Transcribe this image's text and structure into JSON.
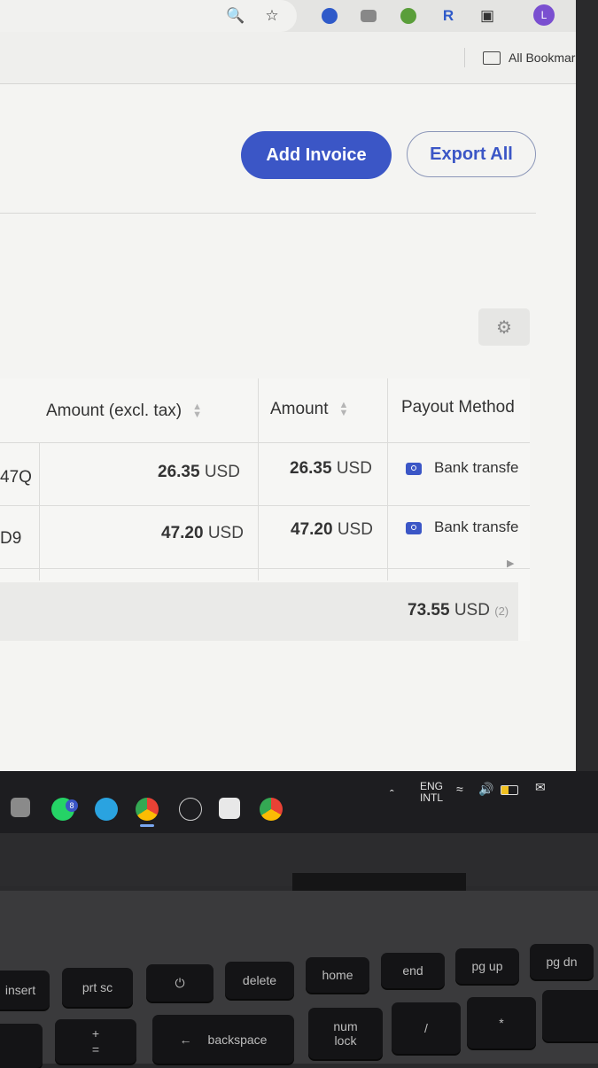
{
  "browser": {
    "profile_initial": "L",
    "bookmarks_label": "All Bookmarks",
    "icons": [
      "zoom-icon",
      "star-icon",
      "extension-icon-1",
      "extension-icon-2",
      "extension-icon-3",
      "extension-icon-4",
      "puzzle-icon",
      "more-vert-icon"
    ]
  },
  "page": {
    "add_invoice_label": "Add Invoice",
    "export_all_label": "Export All",
    "table": {
      "headers": [
        "Amount (excl. tax)",
        "Amount",
        "Payout Method"
      ],
      "rows": [
        {
          "id_fragment": "47Q",
          "amount_excl": "26.35",
          "amount": "26.35",
          "currency": "USD",
          "payout": "Bank transfe"
        },
        {
          "id_fragment": "D9",
          "amount_excl": "47.20",
          "amount": "47.20",
          "currency": "USD",
          "payout": "Bank transfe"
        }
      ],
      "total": {
        "value": "73.55",
        "currency": "USD",
        "count": "(2)"
      }
    },
    "colors": {
      "accent": "#3b56c6"
    }
  },
  "taskbar": {
    "lang_line1": "ENG",
    "lang_line2": "INTL",
    "whatsapp_badge": "8"
  },
  "keyboard": {
    "keys": [
      "insert",
      "prt sc",
      "delete",
      "home",
      "end",
      "pg up",
      "pg dn",
      "+",
      "=",
      "backspace",
      "num",
      "lock",
      "/",
      "*"
    ]
  }
}
